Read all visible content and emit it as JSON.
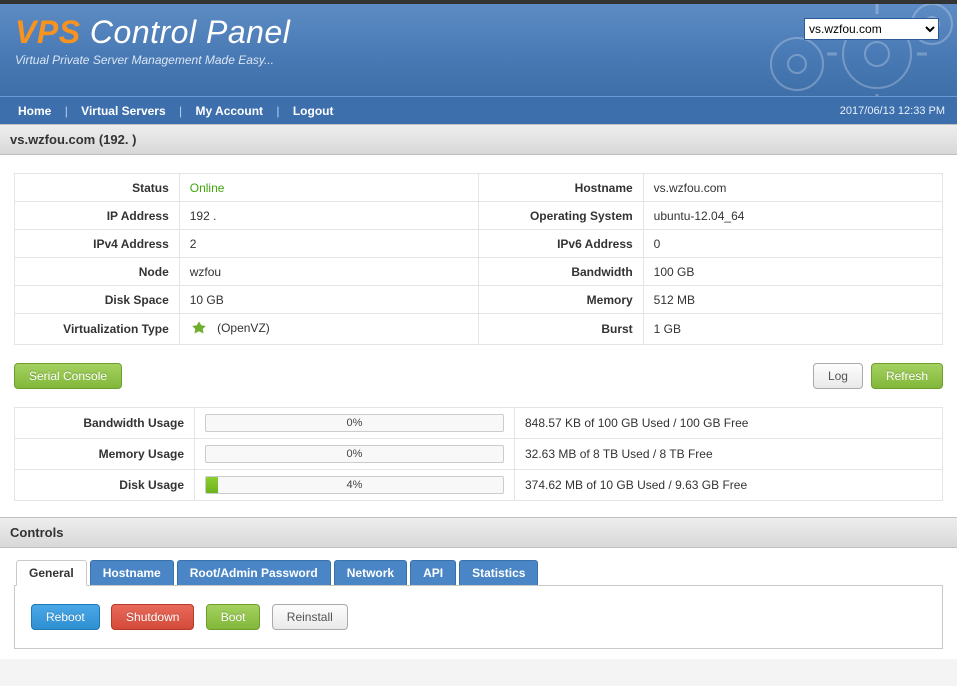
{
  "header": {
    "logo_prefix": "VPS",
    "logo_rest": " Control Panel",
    "tagline": "Virtual Private Server Management Made Easy...",
    "server_select_value": "vs.wzfou.com"
  },
  "nav": {
    "home": "Home",
    "virtual_servers": "Virtual Servers",
    "my_account": "My Account",
    "logout": "Logout",
    "datetime": "2017/06/13 12:33 PM"
  },
  "page_title": "vs.wzfou.com (192.                  )",
  "details": {
    "left": [
      {
        "label": "Status",
        "value": "Online",
        "online": true
      },
      {
        "label": "IP Address",
        "value": "192 ."
      },
      {
        "label": "IPv4 Address",
        "value": "2"
      },
      {
        "label": "Node",
        "value": "wzfou"
      },
      {
        "label": "Disk Space",
        "value": "10 GB"
      },
      {
        "label": "Virtualization Type",
        "value": "(OpenVZ)",
        "ovz": true
      }
    ],
    "right": [
      {
        "label": "Hostname",
        "value": "vs.wzfou.com"
      },
      {
        "label": "Operating System",
        "value": "ubuntu-12.04_64"
      },
      {
        "label": "IPv6 Address",
        "value": "0"
      },
      {
        "label": "Bandwidth",
        "value": "100 GB"
      },
      {
        "label": "Memory",
        "value": "512 MB"
      },
      {
        "label": "Burst",
        "value": "1 GB"
      }
    ]
  },
  "buttons": {
    "serial_console": "Serial Console",
    "log": "Log",
    "refresh": "Refresh"
  },
  "usage": [
    {
      "label": "Bandwidth Usage",
      "pct": 0,
      "text": "848.57 KB of 100 GB Used / 100 GB Free"
    },
    {
      "label": "Memory Usage",
      "pct": 0,
      "text": "32.63 MB of 8 TB Used / 8 TB Free"
    },
    {
      "label": "Disk Usage",
      "pct": 4,
      "text": "374.62 MB of 10 GB Used / 9.63 GB Free"
    }
  ],
  "controls": {
    "title": "Controls",
    "tabs": [
      "General",
      "Hostname",
      "Root/Admin Password",
      "Network",
      "API",
      "Statistics"
    ],
    "active_tab": 0,
    "general_buttons": {
      "reboot": "Reboot",
      "shutdown": "Shutdown",
      "boot": "Boot",
      "reinstall": "Reinstall"
    }
  }
}
